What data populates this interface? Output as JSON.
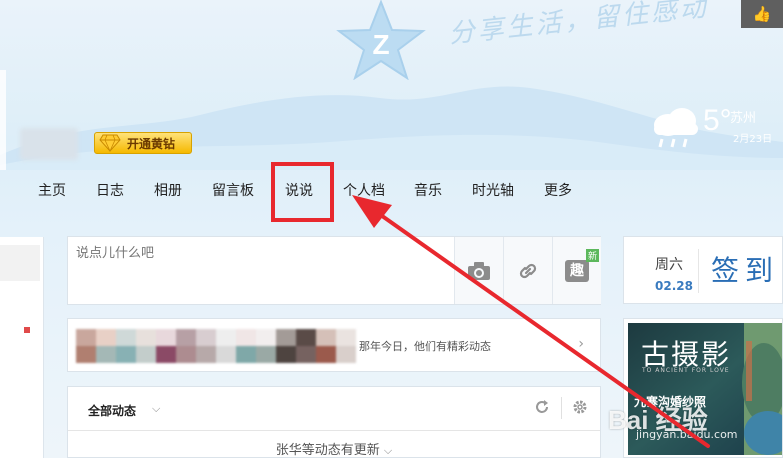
{
  "header": {
    "slogan": "分享生活，留住感动",
    "like_icon": "thumbs-up-icon",
    "vip_label": "开通黄钻"
  },
  "weather": {
    "temp": "5°",
    "city": "苏州",
    "date": "2月23日",
    "icon": "rain-cloud-icon"
  },
  "nav": {
    "items": [
      "主页",
      "日志",
      "相册",
      "留言板",
      "说说",
      "个人档",
      "音乐",
      "时光轴",
      "更多"
    ],
    "highlighted": "说说"
  },
  "composer": {
    "placeholder": "说点儿什么吧",
    "tools": [
      "camera-icon",
      "link-icon",
      "fun-icon"
    ],
    "fun_label": "趣",
    "new_badge": "新"
  },
  "history": {
    "text": "那年今日，他们有精彩动态",
    "arrow": "›"
  },
  "feed": {
    "tab": "全部动态",
    "caret": "⌵",
    "update_text": "张华等动态有更新",
    "update_caret": "⌵"
  },
  "sign": {
    "weekday": "周六",
    "date": "02.28",
    "label": "签到"
  },
  "ad": {
    "title": "古摄影",
    "subtitle": "TO ANCIENT FOR LOVE",
    "caption": "九寨沟婚纱照"
  },
  "watermark": {
    "text": "Bai 经验",
    "url": "jingyan.baidu.com"
  },
  "colors": {
    "highlight": "#e8282e",
    "accent_blue": "#2a6eb5",
    "vip_gold": "#f5b900"
  }
}
